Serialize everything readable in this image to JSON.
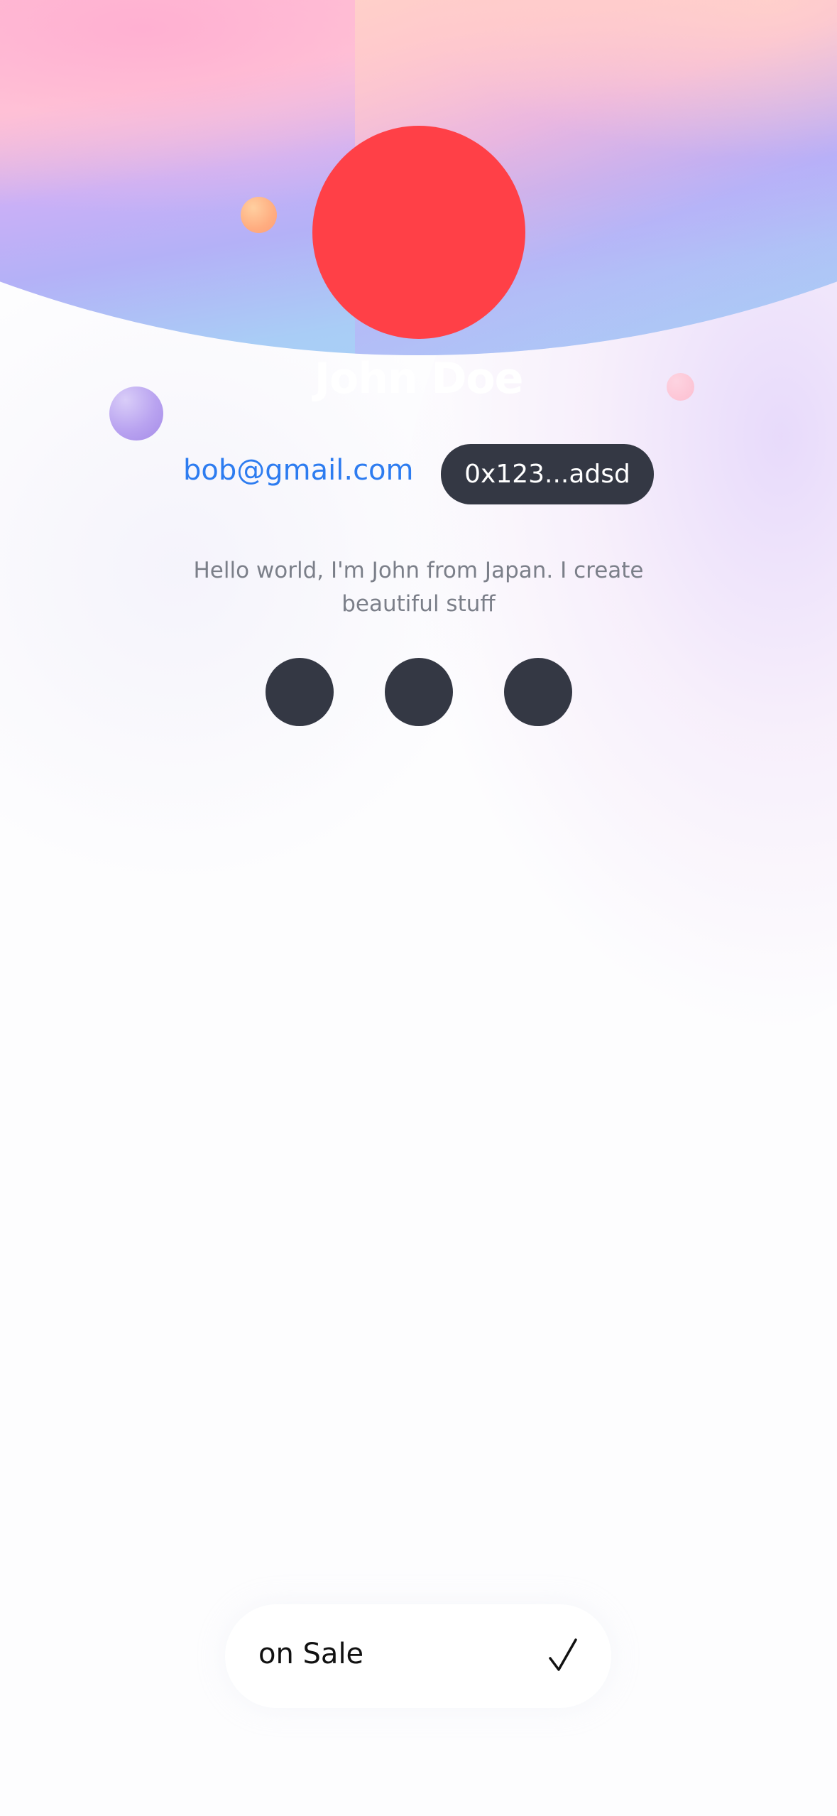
{
  "profile": {
    "name": "John Doe",
    "email": "bob@gmail.com",
    "wallet_address": "0x123...adsd",
    "bio": "Hello world, I'm John from Japan. I create beautiful stuff",
    "avatar_color": "#ff4047"
  },
  "socials": [
    {
      "icon": "social-icon"
    },
    {
      "icon": "social-icon"
    },
    {
      "icon": "social-icon"
    }
  ],
  "filter": {
    "label": "on Sale",
    "checked": true,
    "check_icon": "check-icon"
  },
  "colors": {
    "accent_link": "#2d7cf0",
    "dark": "#343844",
    "muted_text": "#7b7f89"
  }
}
